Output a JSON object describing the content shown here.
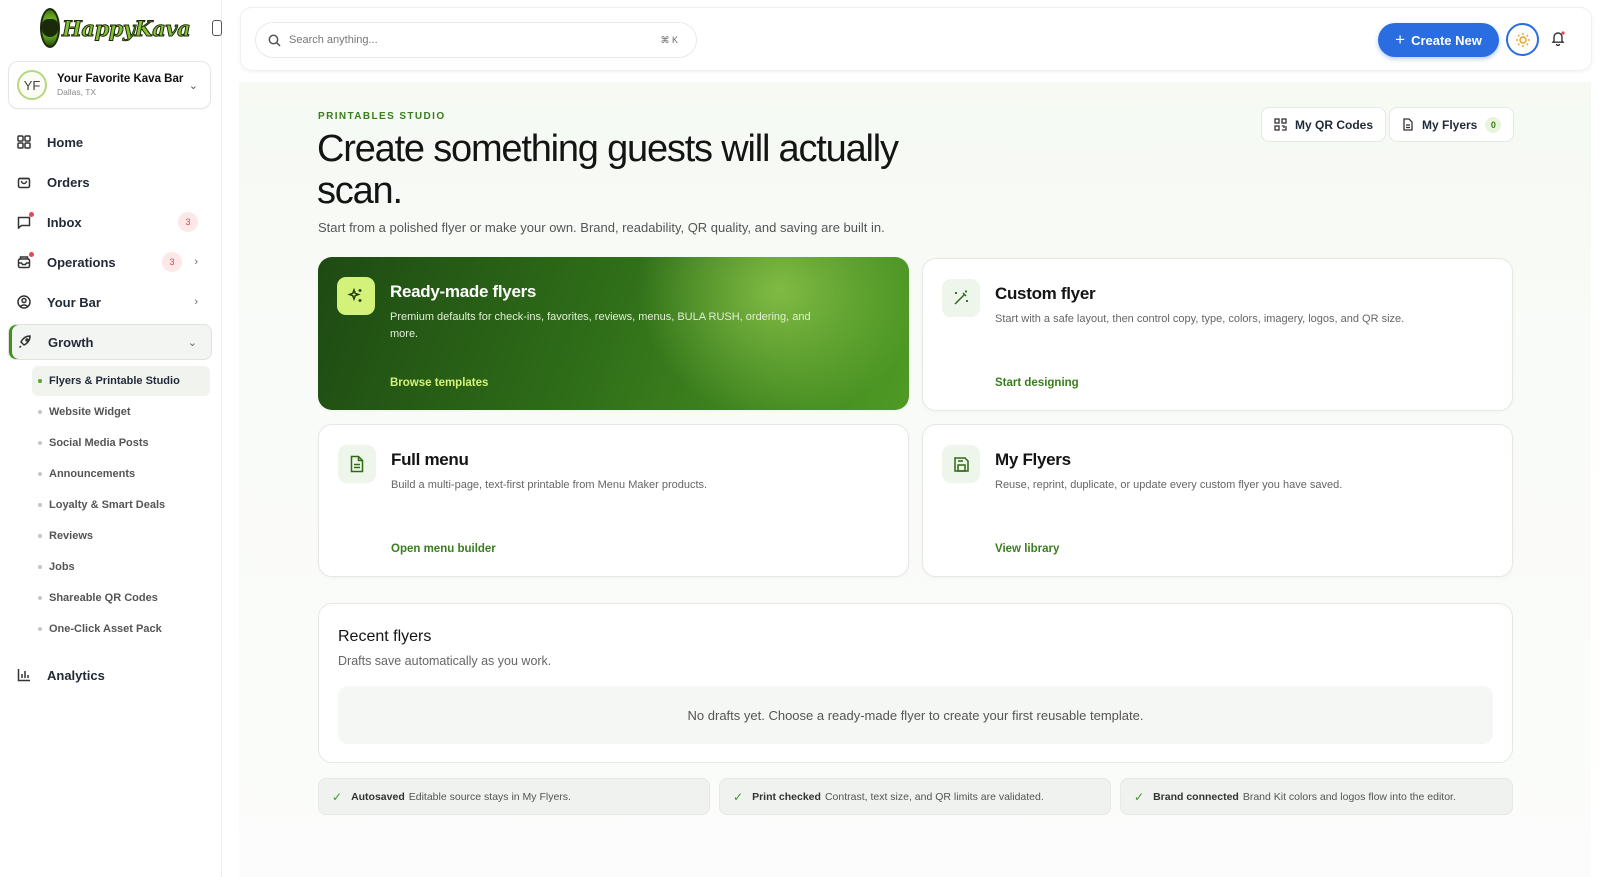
{
  "app": {
    "logo_text": "HappyKava",
    "accent_color": "#3a7d1e",
    "primary_button_color": "#2a6de0"
  },
  "bar_switcher": {
    "initials": "YF",
    "name": "Your Favorite Kava Bar",
    "location": "Dallas, TX"
  },
  "sidebar": {
    "items": [
      {
        "label": "Home",
        "icon": "grid-icon"
      },
      {
        "label": "Orders",
        "icon": "bag-icon"
      },
      {
        "label": "Inbox",
        "icon": "chat-icon",
        "badge": "3"
      },
      {
        "label": "Operations",
        "icon": "tray-icon",
        "badge": "3"
      },
      {
        "label": "Your Bar",
        "icon": "user-circle-icon"
      },
      {
        "label": "Growth",
        "icon": "rocket-icon"
      },
      {
        "label": "Analytics",
        "icon": "bar-chart-icon"
      }
    ],
    "growth_subitems": [
      "Flyers & Printable Studio",
      "Website Widget",
      "Social Media Posts",
      "Announcements",
      "Loyalty & Smart Deals",
      "Reviews",
      "Jobs",
      "Shareable QR Codes",
      "One-Click Asset Pack"
    ]
  },
  "topbar": {
    "search_placeholder": "Search anything...",
    "search_shortcut": "⌘ K",
    "create_label": "Create New"
  },
  "page": {
    "eyebrow": "PRINTABLES STUDIO",
    "headline": "Create something guests will actually scan.",
    "subline": "Start from a polished flyer or make your own. Brand, readability, QR quality, and saving are built in.",
    "qr_button": "My QR Codes",
    "flyers_button": "My Flyers",
    "flyers_count": "0"
  },
  "cards": [
    {
      "title": "Ready-made flyers",
      "desc": "Premium defaults for check-ins, favorites, reviews, menus, BULA RUSH, ordering, and more.",
      "link": "Browse templates",
      "icon": "sparkles-icon"
    },
    {
      "title": "Custom flyer",
      "desc": "Start with a safe layout, then control copy, type, colors, imagery, logos, and QR size.",
      "link": "Start designing",
      "icon": "magic-wand-icon"
    },
    {
      "title": "Full menu",
      "desc": "Build a multi-page, text-first printable from Menu Maker products.",
      "link": "Open menu builder",
      "icon": "document-icon"
    },
    {
      "title": "My Flyers",
      "desc": "Reuse, reprint, duplicate, or update every custom flyer you have saved.",
      "link": "View library",
      "icon": "save-icon"
    }
  ],
  "recent": {
    "title": "Recent flyers",
    "subtitle": "Drafts save automatically as you work.",
    "empty": "No drafts yet. Choose a ready-made flyer to create your first reusable template."
  },
  "features": [
    {
      "bold": "Autosaved",
      "text": "Editable source stays in My Flyers."
    },
    {
      "bold": "Print checked",
      "text": "Contrast, text size, and QR limits are validated."
    },
    {
      "bold": "Brand connected",
      "text": "Brand Kit colors and logos flow into the editor."
    }
  ]
}
